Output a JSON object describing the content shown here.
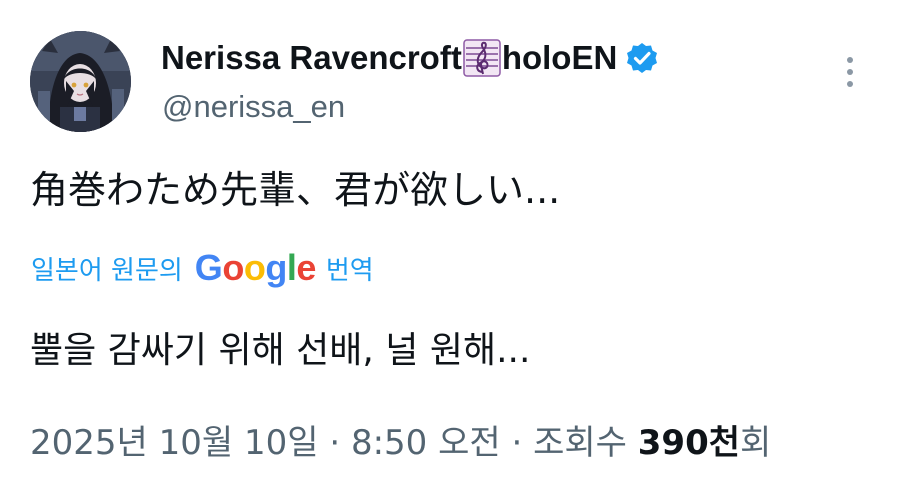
{
  "author": {
    "display_name": "Nerissa Ravencroft",
    "name_emoji": "musical-score-emoji",
    "name_suffix": "holoEN",
    "handle": "@nerissa_en",
    "verified": true,
    "verified_color": "#1d9bf0"
  },
  "more_menu_icon": "more-vertical-icon",
  "tweet": {
    "text": "角巻わため先輩、君が欲しい..."
  },
  "translation": {
    "prefix": "일본어 원문의",
    "google_letters": [
      "G",
      "o",
      "o",
      "g",
      "l",
      "e"
    ],
    "suffix": "번역",
    "link_color": "#1d9bf0",
    "text": "뿔을 감싸기 위해 선배, 널 원해..."
  },
  "meta": {
    "date": "2025년 10월 10일",
    "separator": "·",
    "time": "8:50 오전",
    "views_label_prefix": "조회수",
    "views_count": "390천",
    "views_label_suffix": "회"
  }
}
